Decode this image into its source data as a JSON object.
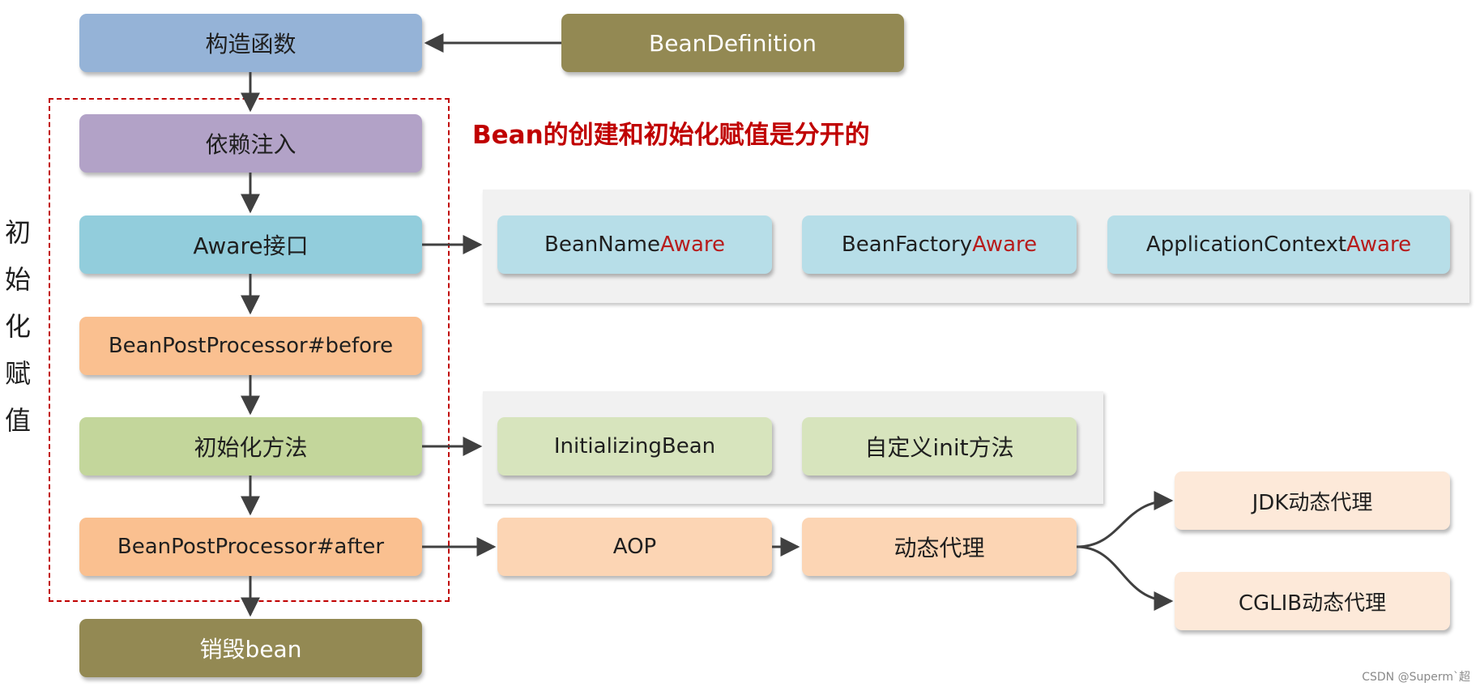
{
  "steps": {
    "constructor": "构造函数",
    "bean_definition": "BeanDefinition",
    "dependency_injection": "依赖注入",
    "aware": "Aware接口",
    "bpp_before": "BeanPostProcessor#before",
    "init_method": "初始化方法",
    "bpp_after": "BeanPostProcessor#after",
    "destroy": "销毁bean"
  },
  "init_label": [
    "初",
    "始",
    "化",
    "赋",
    "值"
  ],
  "headline": "Bean的创建和初始化赋值是分开的",
  "aware_items": [
    {
      "prefix": "BeanName",
      "suffix": "Aware"
    },
    {
      "prefix": "BeanFactory",
      "suffix": "Aware"
    },
    {
      "prefix": "ApplicationContext",
      "suffix": "Aware"
    }
  ],
  "init_items": [
    "InitializingBean",
    "自定义init方法"
  ],
  "aop": {
    "aop": "AOP",
    "dynamic_proxy": "动态代理",
    "jdk_proxy": "JDK动态代理",
    "cglib_proxy": "CGLIB动态代理"
  },
  "watermark": "CSDN @Superm`超",
  "colors": {
    "constructor": "#95b3d7",
    "bean_definition": "#938953",
    "dependency_injection": "#b2a2c7",
    "aware": "#92cddc",
    "bpp": "#fac090",
    "init_method": "#c3d69b",
    "destroy": "#938953",
    "aware_item": "#b7dee8",
    "init_item": "#d7e4bd",
    "aop_item": "#fcd5b4",
    "proxy_item": "#fde9d9",
    "highlight": "#c00000",
    "arrow": "#404040"
  },
  "icons": [
    "arrow-right-icon",
    "arrow-down-icon",
    "arrow-left-icon"
  ]
}
